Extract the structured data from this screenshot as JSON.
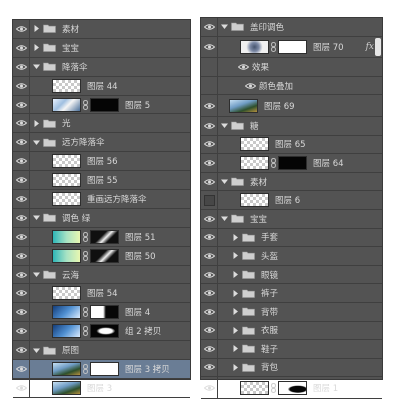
{
  "left_panel": {
    "rows": [
      {
        "type": "group",
        "indent": 0,
        "expanded": false,
        "label": "素材"
      },
      {
        "type": "group",
        "indent": 0,
        "expanded": false,
        "label": "宝宝"
      },
      {
        "type": "group",
        "indent": 0,
        "expanded": true,
        "label": "降落伞"
      },
      {
        "type": "layer",
        "indent": 1,
        "thumb": "checker",
        "label": "图层 44"
      },
      {
        "type": "layer",
        "indent": 1,
        "thumb": "photo",
        "link": true,
        "mask": "mask-dark",
        "label": "图层 5"
      },
      {
        "type": "group",
        "indent": 0,
        "expanded": false,
        "label": "光"
      },
      {
        "type": "group",
        "indent": 0,
        "expanded": true,
        "label": "远方降落伞"
      },
      {
        "type": "layer",
        "indent": 1,
        "thumb": "checker",
        "label": "图层 56"
      },
      {
        "type": "layer",
        "indent": 1,
        "thumb": "checker",
        "label": "图层 55"
      },
      {
        "type": "layer",
        "indent": 1,
        "thumb": "checker",
        "label": "重画远方降落伞"
      },
      {
        "type": "group",
        "indent": 0,
        "expanded": true,
        "label": "调色 绿"
      },
      {
        "type": "layer",
        "indent": 1,
        "thumb": "gradient",
        "link": true,
        "mask": "mask-stroke",
        "label": "图层 51"
      },
      {
        "type": "layer",
        "indent": 1,
        "thumb": "gradient",
        "link": true,
        "mask": "mask-stroke",
        "label": "图层 50"
      },
      {
        "type": "group",
        "indent": 0,
        "expanded": true,
        "label": "云海"
      },
      {
        "type": "layer",
        "indent": 1,
        "thumb": "checker",
        "label": "图层 54"
      },
      {
        "type": "layer",
        "indent": 1,
        "thumb": "sky",
        "link": true,
        "mask": "mask-split",
        "label": "图层 4"
      },
      {
        "type": "layer",
        "indent": 1,
        "thumb": "sky",
        "link": true,
        "mask": "mask-blob",
        "label": "组 2 拷贝"
      },
      {
        "type": "group",
        "indent": 0,
        "expanded": true,
        "label": "原图"
      },
      {
        "type": "layer",
        "indent": 1,
        "thumb": "city",
        "link": true,
        "mask": "mask-white",
        "label": "图层 3 拷贝",
        "selected": true
      },
      {
        "type": "layer",
        "indent": 1,
        "thumb": "city",
        "label": "图层 3"
      }
    ]
  },
  "right_panel": {
    "rows": [
      {
        "type": "group",
        "indent": 0,
        "expanded": true,
        "label": "盖印调色"
      },
      {
        "type": "layer",
        "indent": 1,
        "thumb": "parachute",
        "link": true,
        "mask": "mask-white",
        "label": "图层 70",
        "fx": "fx",
        "tall": true
      },
      {
        "type": "effects",
        "indent": 1,
        "label": "效果"
      },
      {
        "type": "effect",
        "indent": 2,
        "label": "颜色叠加"
      },
      {
        "type": "layer",
        "indent": 0,
        "thumb": "city",
        "label": "图层 69",
        "tall": true
      },
      {
        "type": "group",
        "indent": 0,
        "expanded": true,
        "label": "糖"
      },
      {
        "type": "layer",
        "indent": 1,
        "thumb": "checker",
        "label": "图层 65"
      },
      {
        "type": "layer",
        "indent": 1,
        "thumb": "checker",
        "link": true,
        "mask": "mask-dark",
        "label": "图层 64"
      },
      {
        "type": "group",
        "indent": 0,
        "expanded": true,
        "label": "素材"
      },
      {
        "type": "layer",
        "indent": 1,
        "thumb": "checker",
        "label": "图层 6",
        "hidden": true
      },
      {
        "type": "group",
        "indent": 0,
        "expanded": true,
        "label": "宝宝"
      },
      {
        "type": "group",
        "indent": 1,
        "expanded": false,
        "label": "手套"
      },
      {
        "type": "group",
        "indent": 1,
        "expanded": false,
        "label": "头盔"
      },
      {
        "type": "group",
        "indent": 1,
        "expanded": false,
        "label": "眼镜"
      },
      {
        "type": "group",
        "indent": 1,
        "expanded": false,
        "label": "裤子"
      },
      {
        "type": "group",
        "indent": 1,
        "expanded": false,
        "label": "背带"
      },
      {
        "type": "group",
        "indent": 1,
        "expanded": false,
        "label": "衣服"
      },
      {
        "type": "group",
        "indent": 1,
        "expanded": false,
        "label": "鞋子"
      },
      {
        "type": "group",
        "indent": 1,
        "expanded": false,
        "label": "背包"
      },
      {
        "type": "layer",
        "indent": 1,
        "thumb": "checker",
        "link": true,
        "mask": "mask-fill",
        "label": "图层 1",
        "tall": true
      }
    ]
  },
  "icons": {
    "eye": "eye-icon",
    "arrow_collapsed": "triangle-right-icon",
    "arrow_expanded": "triangle-down-icon",
    "folder": "folder-icon",
    "link": "chain-link-icon",
    "effects": "effects-eye-icon"
  },
  "colors": {
    "panel_bg": "#535353",
    "row_border": "#3f3f3f",
    "text": "#d9d9d9",
    "selected_bg": "#6a7d95",
    "hidden_box": "#474747"
  }
}
